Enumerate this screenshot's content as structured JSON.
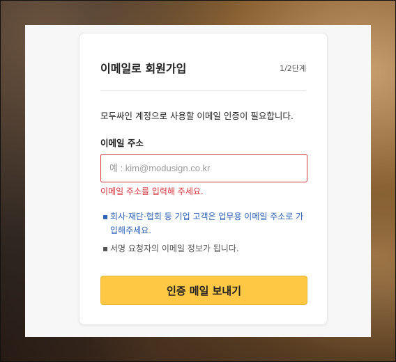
{
  "signup": {
    "title": "이메일로 회원가입",
    "step": "1/2단계",
    "description": "모두싸인 계정으로 사용할 이메일 인증이 필요합니다.",
    "email_label": "이메일 주소",
    "email_placeholder": "예 : kim@modusign.co.kr",
    "email_value": "",
    "error_message": "이메일 주소를 입력해 주세요.",
    "notes": [
      "회사·재단·협회 등 기업 고객은 업무용 이메일 주소로 가입해주세요.",
      "서명 요청자의 이메일 정보가 됩니다."
    ],
    "bullet": "▪",
    "send_button": "인증 메일 보내기"
  },
  "colors": {
    "accent_button": "#fec844",
    "error": "#d9363e",
    "link_note": "#2c63b6"
  }
}
